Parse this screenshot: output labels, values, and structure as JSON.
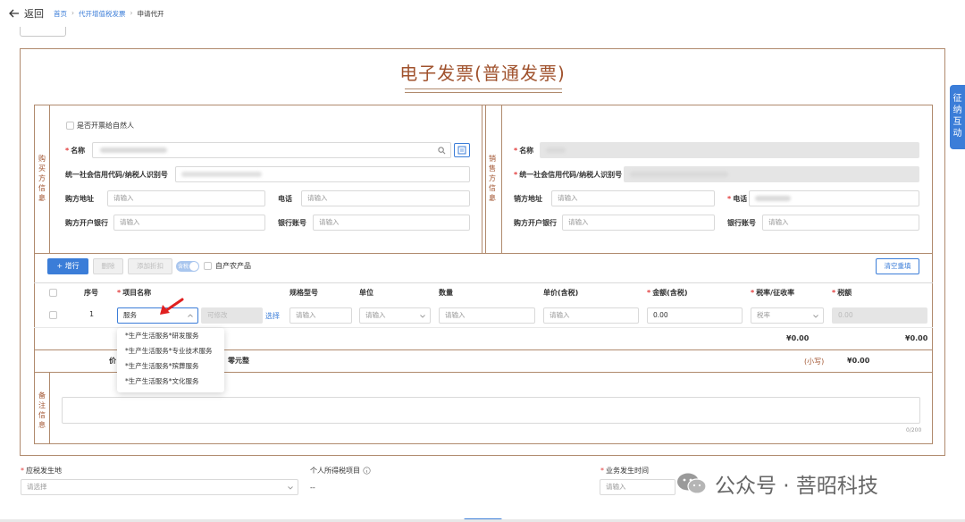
{
  "header": {
    "back_label": "返回",
    "breadcrumb": [
      "首页",
      "代开增值税发票",
      "申请代开"
    ]
  },
  "invoice": {
    "title": "电子发票(普通发票)"
  },
  "buyer": {
    "section_label": "购买方信息",
    "natural_person_label": "是否开票给自然人",
    "name_label": "名称",
    "tax_id_label": "统一社会信用代码/纳税人识别号",
    "address_label": "购方地址",
    "address_placeholder": "请输入",
    "phone_label": "电话",
    "phone_placeholder": "请输入",
    "bank_label": "购方开户银行",
    "bank_placeholder": "请输入",
    "account_label": "银行账号",
    "account_placeholder": "请输入"
  },
  "seller": {
    "section_label": "销售方信息",
    "name_label": "名称",
    "tax_id_label": "统一社会信用代码/纳税人识别号",
    "address_label": "销方地址",
    "address_placeholder": "请输入",
    "phone_label": "电话",
    "bank_label": "购方开户银行",
    "bank_placeholder": "请输入",
    "account_label": "银行账号",
    "account_placeholder": "请输入"
  },
  "toolbar": {
    "add_row": "增行",
    "delete": "删除",
    "add_discount": "添加折扣",
    "toggle_label": "含税",
    "self_produced_label": "自产农产品",
    "clear_refill": "清空重填"
  },
  "table": {
    "headers": {
      "seq": "序号",
      "item_name": "项目名称",
      "spec": "规格型号",
      "unit": "单位",
      "qty": "数量",
      "price": "单价(含税)",
      "amount": "金额(含税)",
      "rate": "税率/征收率",
      "tax": "税额"
    },
    "row": {
      "seq": "1",
      "item_name_value": "服务",
      "editable_placeholder": "可修改",
      "select_link": "选择",
      "spec_placeholder": "请输入",
      "unit_placeholder": "请输入",
      "qty_placeholder": "请输入",
      "price_placeholder": "请输入",
      "amount_value": "0.00",
      "rate_placeholder": "税率",
      "tax_value": "0.00"
    },
    "subtotal_amount": "¥0.00",
    "subtotal_tax": "¥0.00",
    "total_label_fragment": "价",
    "total_words_fragment": "零元整",
    "small_label": "(小写)",
    "small_value": "¥0.00"
  },
  "dropdown": {
    "options": [
      "*生产生活服务*研发服务",
      "*生产生活服务*专业技术服务",
      "*生产生活服务*殡葬服务",
      "*生产生活服务*文化服务"
    ]
  },
  "remarks": {
    "section_label": "备注信息",
    "counter": "0/200"
  },
  "footer_form": {
    "tax_place_label": "应税发生地",
    "tax_place_placeholder": "请选择",
    "personal_tax_label": "个人所得税项目",
    "personal_tax_value": "--",
    "business_time_label": "业务发生时间",
    "business_time_placeholder": "请输入"
  },
  "side_tab": {
    "label": "征纳互动"
  },
  "watermark": {
    "text": "公众号 · 菩昭科技"
  },
  "colors": {
    "accent": "#3b7dd8",
    "frame": "#b08a6d",
    "title": "#a0522d",
    "required": "#e23b3b",
    "arrow": "#e02020"
  }
}
